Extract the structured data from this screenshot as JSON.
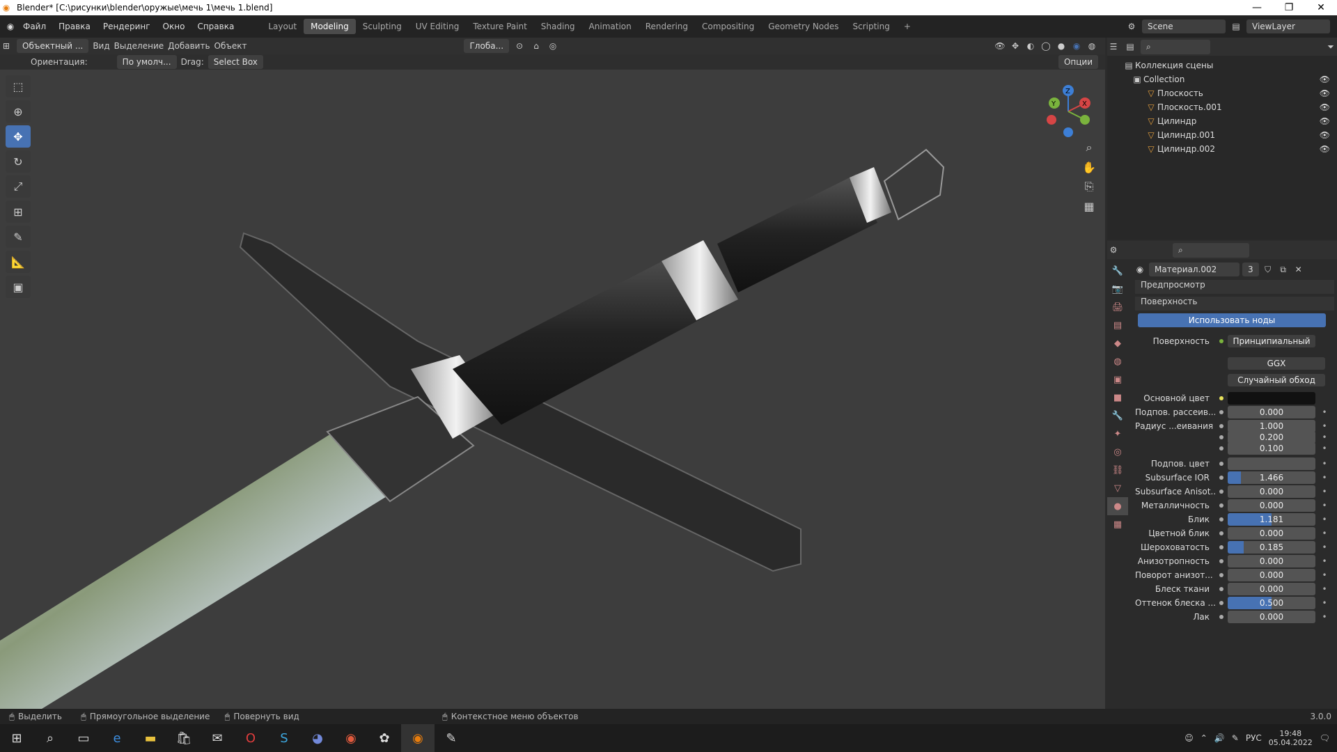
{
  "window": {
    "title": "Blender* [C:\\рисунки\\blender\\оружые\\мечь 1\\мечь 1.blend]"
  },
  "menu": [
    "Файл",
    "Правка",
    "Рендеринг",
    "Окно",
    "Справка"
  ],
  "workspaces": [
    "Layout",
    "Modeling",
    "Sculpting",
    "UV Editing",
    "Texture Paint",
    "Shading",
    "Animation",
    "Rendering",
    "Compositing",
    "Geometry Nodes",
    "Scripting"
  ],
  "active_workspace": "Modeling",
  "scene": {
    "scene_name": "Scene",
    "view_layer": "ViewLayer"
  },
  "viewport_header": {
    "mode": "Объектный ...",
    "menus": [
      "Вид",
      "Выделение",
      "Добавить",
      "Объект"
    ],
    "transform": "Глоба...",
    "options": "Опции"
  },
  "tool_settings": {
    "orientation_label": "Ориентация:",
    "orientation_value": "По умолч...",
    "drag_label": "Drag:",
    "drag_value": "Select Box"
  },
  "outliner": {
    "scene_collection": "Коллекция сцены",
    "collection": "Collection",
    "objects": [
      "Плоскость",
      "Плоскость.001",
      "Цилиндр",
      "Цилиндр.001",
      "Цилиндр.002"
    ]
  },
  "properties": {
    "material_name": "Материал.002",
    "material_users": "3",
    "preview_panel": "Предпросмотр",
    "surface_panel": "Поверхность",
    "use_nodes": "Использовать ноды",
    "surface_label": "Поверхность",
    "surface_value": "Принципиальный BS...",
    "distribution": "GGX",
    "subsurface_method": "Случайный обход",
    "base_color_label": "Основной цвет",
    "rows": [
      {
        "label": "Подпов. рассеив...",
        "value": "0.000",
        "fill": 0
      },
      {
        "label": "Радиус ...еивания",
        "value": "1.000",
        "fill": 0
      },
      {
        "label": "",
        "value": "0.200",
        "fill": 0
      },
      {
        "label": "",
        "value": "0.100",
        "fill": 0
      },
      {
        "label": "Подпов. цвет",
        "value": "",
        "fill": 0
      },
      {
        "label": "Subsurface IOR",
        "value": "1.466",
        "fill": 0.15
      },
      {
        "label": "Subsurface Anisot...",
        "value": "0.000",
        "fill": 0
      },
      {
        "label": "Металличность",
        "value": "0.000",
        "fill": 0
      },
      {
        "label": "Блик",
        "value": "1.181",
        "fill": 0.5
      },
      {
        "label": "Цветной блик",
        "value": "0.000",
        "fill": 0
      },
      {
        "label": "Шероховатость",
        "value": "0.185",
        "fill": 0.185
      },
      {
        "label": "Анизотропность",
        "value": "0.000",
        "fill": 0
      },
      {
        "label": "Поворот анизот...",
        "value": "0.000",
        "fill": 0
      },
      {
        "label": "Блеск ткани",
        "value": "0.000",
        "fill": 0
      },
      {
        "label": "Оттенок блеска ...",
        "value": "0.500",
        "fill": 0.5
      },
      {
        "label": "Лак",
        "value": "0.000",
        "fill": 0
      }
    ]
  },
  "statusbar": {
    "select": "Выделить",
    "box_select": "Прямоугольное выделение",
    "rotate": "Повернуть вид",
    "context": "Контекстное меню объектов",
    "version": "3.0.0"
  },
  "taskbar": {
    "lang": "РУС",
    "time": "19:48",
    "date": "05.04.2022"
  },
  "colors": {
    "accent": "#4772b3",
    "panel": "#303030",
    "bg": "#3d3d3d"
  }
}
